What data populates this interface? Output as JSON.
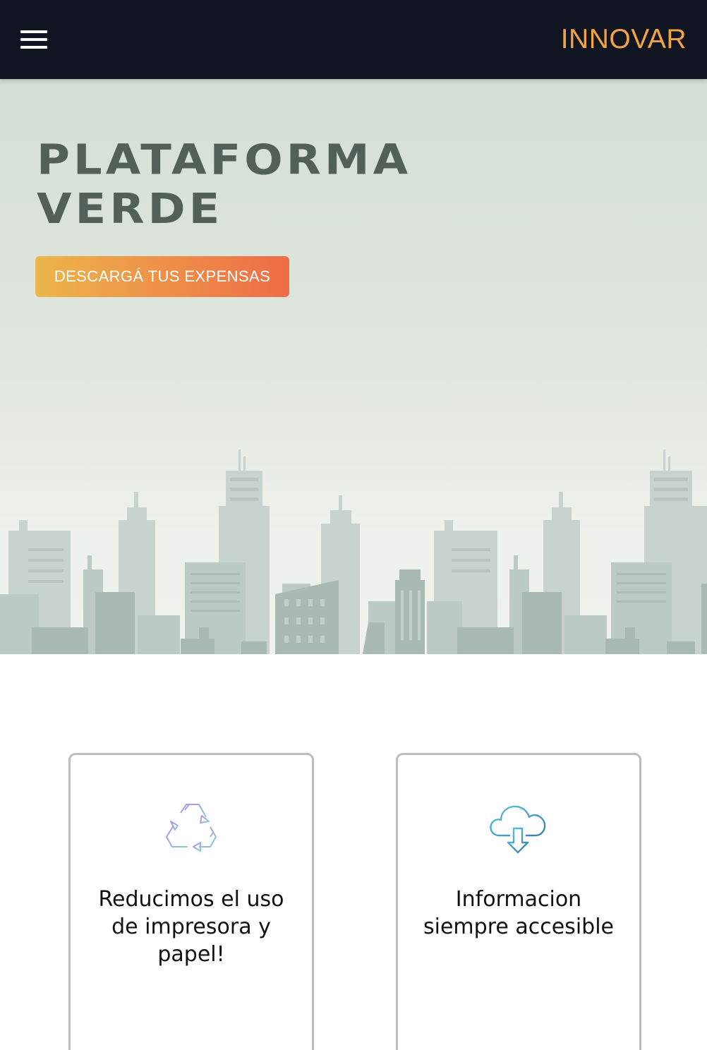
{
  "header": {
    "menu_icon": "hamburger-menu-icon",
    "brand": "INNOVAR",
    "brand_color": "#F2A444",
    "background": "#111421"
  },
  "hero": {
    "title_line1": "PLATAFORMA",
    "title_line2": "VERDE",
    "cta_label": "DESCARGÁ TUS EXPENSAS",
    "cta_gradient": [
      "#EDB54B",
      "#EE6C47"
    ],
    "illustration": "city-skyline-illustration"
  },
  "features": [
    {
      "icon": "recycle-icon",
      "text": "Reducimos el uso de impresora y papel!"
    },
    {
      "icon": "cloud-download-icon",
      "text": "Informacion siempre accesible"
    }
  ]
}
